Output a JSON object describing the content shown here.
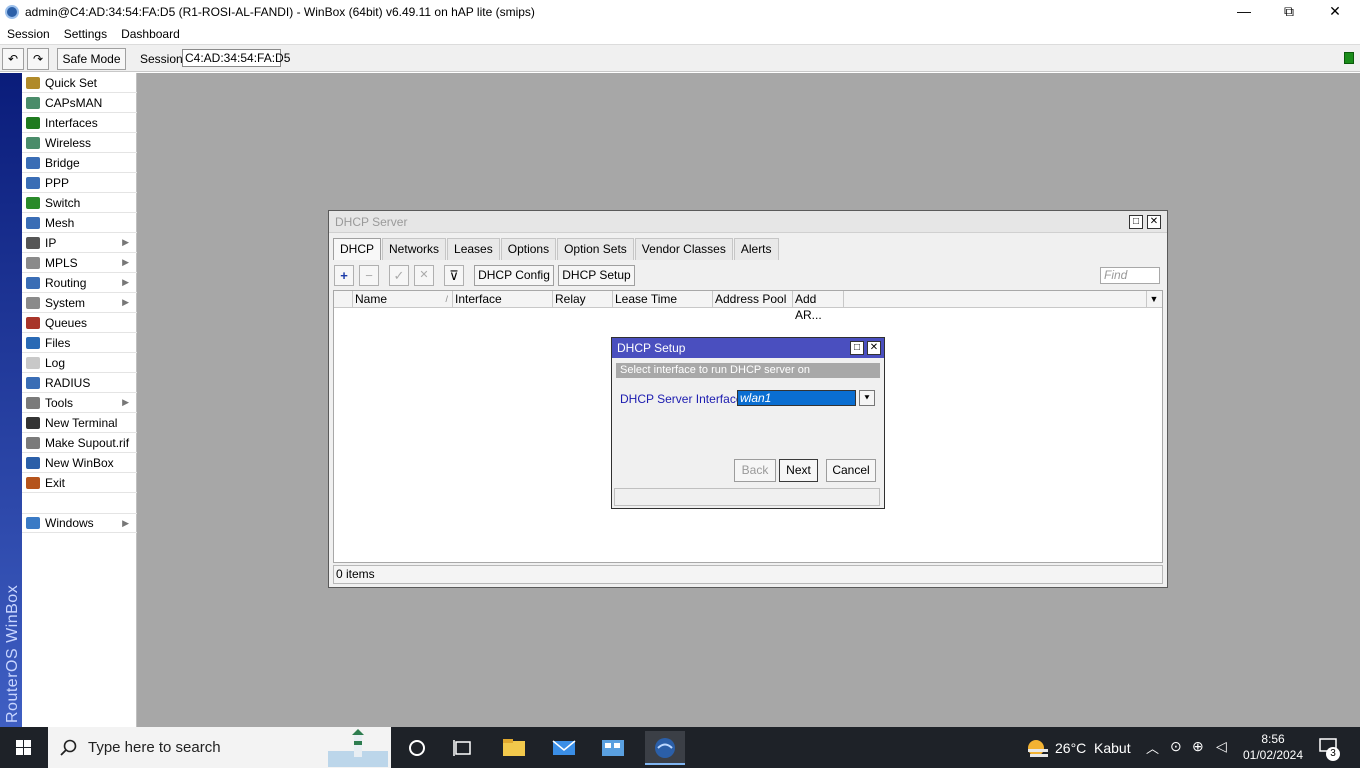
{
  "window": {
    "title": "admin@C4:AD:34:54:FA:D5 (R1-ROSI-AL-FANDI) - WinBox (64bit) v6.49.11 on hAP lite (smips)",
    "controls": [
      "—",
      "⧉",
      "✕"
    ]
  },
  "menu": {
    "items": [
      "Session",
      "Settings",
      "Dashboard"
    ]
  },
  "toolbar": {
    "undo_icon": "↶",
    "redo_icon": "↷",
    "safe_mode": "Safe Mode",
    "session_label": "Session:",
    "session_value": "C4:AD:34:54:FA:D5"
  },
  "brand": "RouterOS WinBox",
  "sidebar": {
    "items": [
      {
        "label": "Quick Set",
        "icon": "wand-icon",
        "color": "#b08a2a",
        "submenu": false
      },
      {
        "label": "CAPsMAN",
        "icon": "antenna-icon",
        "color": "#4a8c6a",
        "submenu": false
      },
      {
        "label": "Interfaces",
        "icon": "interfaces-icon",
        "color": "#1f7a1f",
        "submenu": false
      },
      {
        "label": "Wireless",
        "icon": "wireless-icon",
        "color": "#4a8c6a",
        "submenu": false
      },
      {
        "label": "Bridge",
        "icon": "bridge-icon",
        "color": "#3a6db5",
        "submenu": false
      },
      {
        "label": "PPP",
        "icon": "ppp-icon",
        "color": "#3a6db5",
        "submenu": false
      },
      {
        "label": "Switch",
        "icon": "switch-icon",
        "color": "#2a8a2a",
        "submenu": false
      },
      {
        "label": "Mesh",
        "icon": "mesh-icon",
        "color": "#3a6db5",
        "submenu": false
      },
      {
        "label": "IP",
        "icon": "ip-icon",
        "color": "#555555",
        "submenu": true
      },
      {
        "label": "MPLS",
        "icon": "mpls-icon",
        "color": "#8a8a8a",
        "submenu": true
      },
      {
        "label": "Routing",
        "icon": "routing-icon",
        "color": "#3a6db5",
        "submenu": true
      },
      {
        "label": "System",
        "icon": "gear-icon",
        "color": "#8a8a8a",
        "submenu": true
      },
      {
        "label": "Queues",
        "icon": "queues-icon",
        "color": "#a8352a",
        "submenu": false
      },
      {
        "label": "Files",
        "icon": "folder-icon",
        "color": "#2a6ab5",
        "submenu": false
      },
      {
        "label": "Log",
        "icon": "log-icon",
        "color": "#c8c8c8",
        "submenu": false
      },
      {
        "label": "RADIUS",
        "icon": "radius-icon",
        "color": "#3a6db5",
        "submenu": false
      },
      {
        "label": "Tools",
        "icon": "tools-icon",
        "color": "#7a7a7a",
        "submenu": true
      },
      {
        "label": "New Terminal",
        "icon": "terminal-icon",
        "color": "#333333",
        "submenu": false
      },
      {
        "label": "Make Supout.rif",
        "icon": "supout-icon",
        "color": "#7a7a7a",
        "submenu": false
      },
      {
        "label": "New WinBox",
        "icon": "winbox-icon",
        "color": "#2b5fa8",
        "submenu": false
      },
      {
        "label": "Exit",
        "icon": "exit-icon",
        "color": "#b5541c",
        "submenu": false
      }
    ],
    "windows": {
      "label": "Windows",
      "icon": "windows-icon",
      "color": "#3a7ac5",
      "submenu": true
    }
  },
  "dhcp_server": {
    "title": "DHCP Server",
    "tabs": [
      "DHCP",
      "Networks",
      "Leases",
      "Options",
      "Option Sets",
      "Vendor Classes",
      "Alerts"
    ],
    "buttons": {
      "add": "+",
      "remove": "−",
      "enable": "✓",
      "disable": "✕",
      "filter": "⊽",
      "config": "DHCP Config",
      "setup": "DHCP Setup"
    },
    "find_placeholder": "Find",
    "columns": [
      "Name",
      "Interface",
      "Relay",
      "Lease Time",
      "Address Pool",
      "Add AR..."
    ],
    "sort_mark": "/",
    "dropdown": "▼",
    "items_count": "0 items"
  },
  "dhcp_setup": {
    "title": "DHCP Setup",
    "hint": "Select interface to run DHCP server on",
    "field_label": "DHCP Server Interface:",
    "field_value": "wlan1",
    "dropdown": "⯆",
    "back": "Back",
    "next": "Next",
    "cancel": "Cancel"
  },
  "taskbar": {
    "search_placeholder": "Type here to search",
    "weather_temp": "26°C",
    "weather_text": "Kabut",
    "time": "8:56",
    "date": "01/02/2024",
    "notification_count": "3"
  }
}
